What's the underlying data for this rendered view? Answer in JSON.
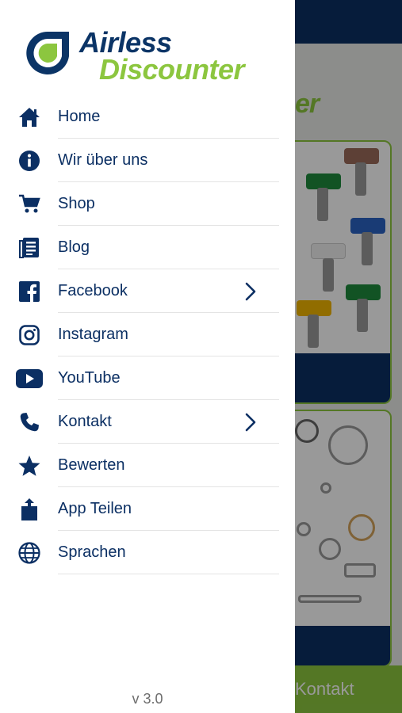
{
  "brand": {
    "line1": "Airless",
    "line2": "Discounter",
    "primary": "#0b2f63",
    "accent": "#8cc63f"
  },
  "menu": {
    "items": [
      {
        "label": "Home",
        "icon": "home-icon",
        "chevron": false
      },
      {
        "label": "Wir über uns",
        "icon": "info-icon",
        "chevron": false
      },
      {
        "label": "Shop",
        "icon": "cart-icon",
        "chevron": false
      },
      {
        "label": "Blog",
        "icon": "blog-icon",
        "chevron": false
      },
      {
        "label": "Facebook",
        "icon": "facebook-icon",
        "chevron": true
      },
      {
        "label": "Instagram",
        "icon": "instagram-icon",
        "chevron": false
      },
      {
        "label": "YouTube",
        "icon": "youtube-icon",
        "chevron": false
      },
      {
        "label": "Kontakt",
        "icon": "phone-icon",
        "chevron": true
      },
      {
        "label": "Bewerten",
        "icon": "star-icon",
        "chevron": false
      },
      {
        "label": "App Teilen",
        "icon": "share-icon",
        "chevron": false
      },
      {
        "label": "Sprachen",
        "icon": "globe-icon",
        "chevron": false
      }
    ]
  },
  "version": "v 3.0",
  "background": {
    "logo_fragment": "er",
    "bottom_bar_label": "Kontakt"
  }
}
